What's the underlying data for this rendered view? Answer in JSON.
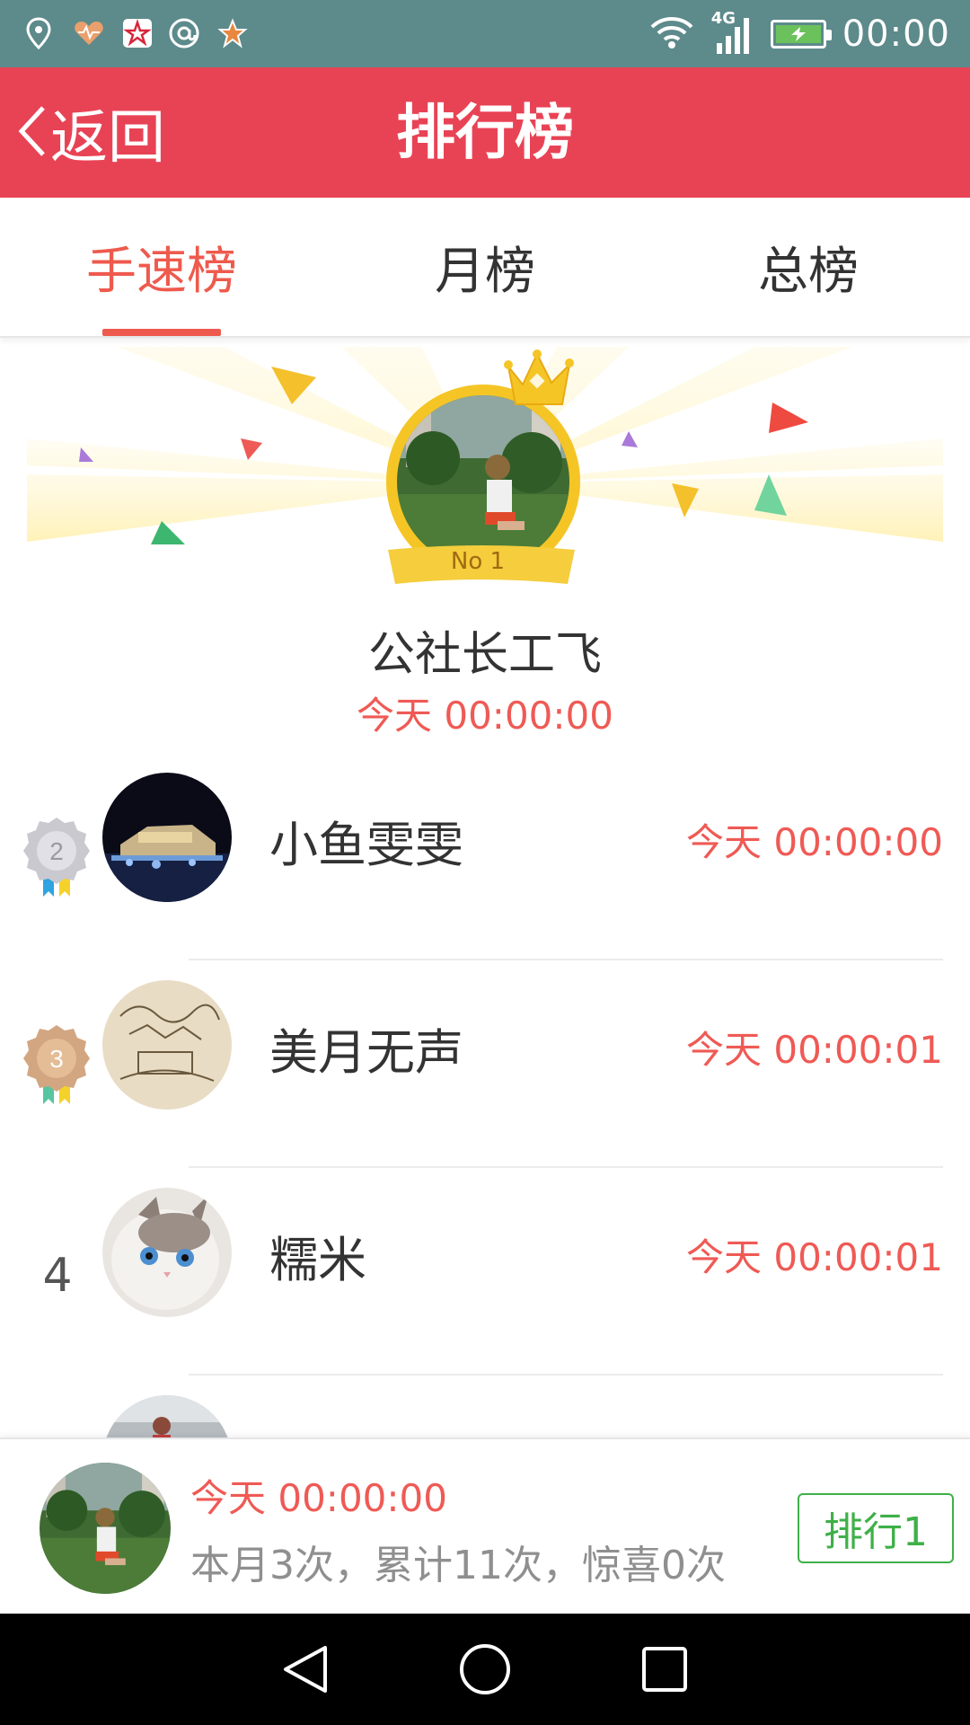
{
  "status_bar": {
    "time": "00:00",
    "network": "4G",
    "left_icons": [
      "location-pin-icon",
      "heart-rate-icon",
      "star-badge-icon",
      "at-sign-icon",
      "star-icon"
    ]
  },
  "header": {
    "back_label": "返回",
    "title": "排行榜",
    "background_color": "#e84355"
  },
  "tabs": [
    {
      "label": "手速榜",
      "active": true
    },
    {
      "label": "月榜",
      "active": false
    },
    {
      "label": "总榜",
      "active": false
    }
  ],
  "champion": {
    "badge": "No 1",
    "name": "公社长工飞",
    "time": "今天 00:00:00"
  },
  "rankings": [
    {
      "rank": "2",
      "name": "小鱼雯雯",
      "time": "今天 00:00:00",
      "badge": "silver-medal-icon"
    },
    {
      "rank": "3",
      "name": "美月无声",
      "time": "今天 00:00:01",
      "badge": "bronze-medal-icon"
    },
    {
      "rank": "4",
      "name": "糯米",
      "time": "今天 00:00:01",
      "badge": ""
    }
  ],
  "user_bar": {
    "time": "今天 00:00:00",
    "stats": "本月3次，累计11次，惊喜0次",
    "rank_button": "排行1"
  },
  "nav_bar": {
    "buttons": [
      "back-triangle-icon",
      "home-circle-icon",
      "recents-square-icon"
    ]
  },
  "colors": {
    "accent_red": "#ee5a4d",
    "time_red": "#ef5a55",
    "green": "#3eb048",
    "gold": "#f5c526"
  }
}
